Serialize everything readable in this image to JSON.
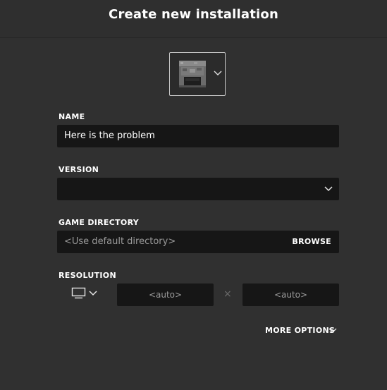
{
  "header": {
    "title": "Create new installation"
  },
  "icon_picker": {
    "icon": "furnace-icon"
  },
  "name": {
    "label": "NAME",
    "value": "Here is the problem"
  },
  "version": {
    "label": "VERSION",
    "value": ""
  },
  "game_directory": {
    "label": "GAME DIRECTORY",
    "placeholder": "<Use default directory>",
    "browse_label": "BROWSE"
  },
  "resolution": {
    "label": "RESOLUTION",
    "width_placeholder": "<auto>",
    "height_placeholder": "<auto>",
    "separator": "×"
  },
  "more_options": {
    "label": "MORE OPTIONS"
  },
  "colors": {
    "background": "#303030",
    "field": "#161616",
    "text": "#ffffff",
    "muted": "#9a9a9a"
  }
}
